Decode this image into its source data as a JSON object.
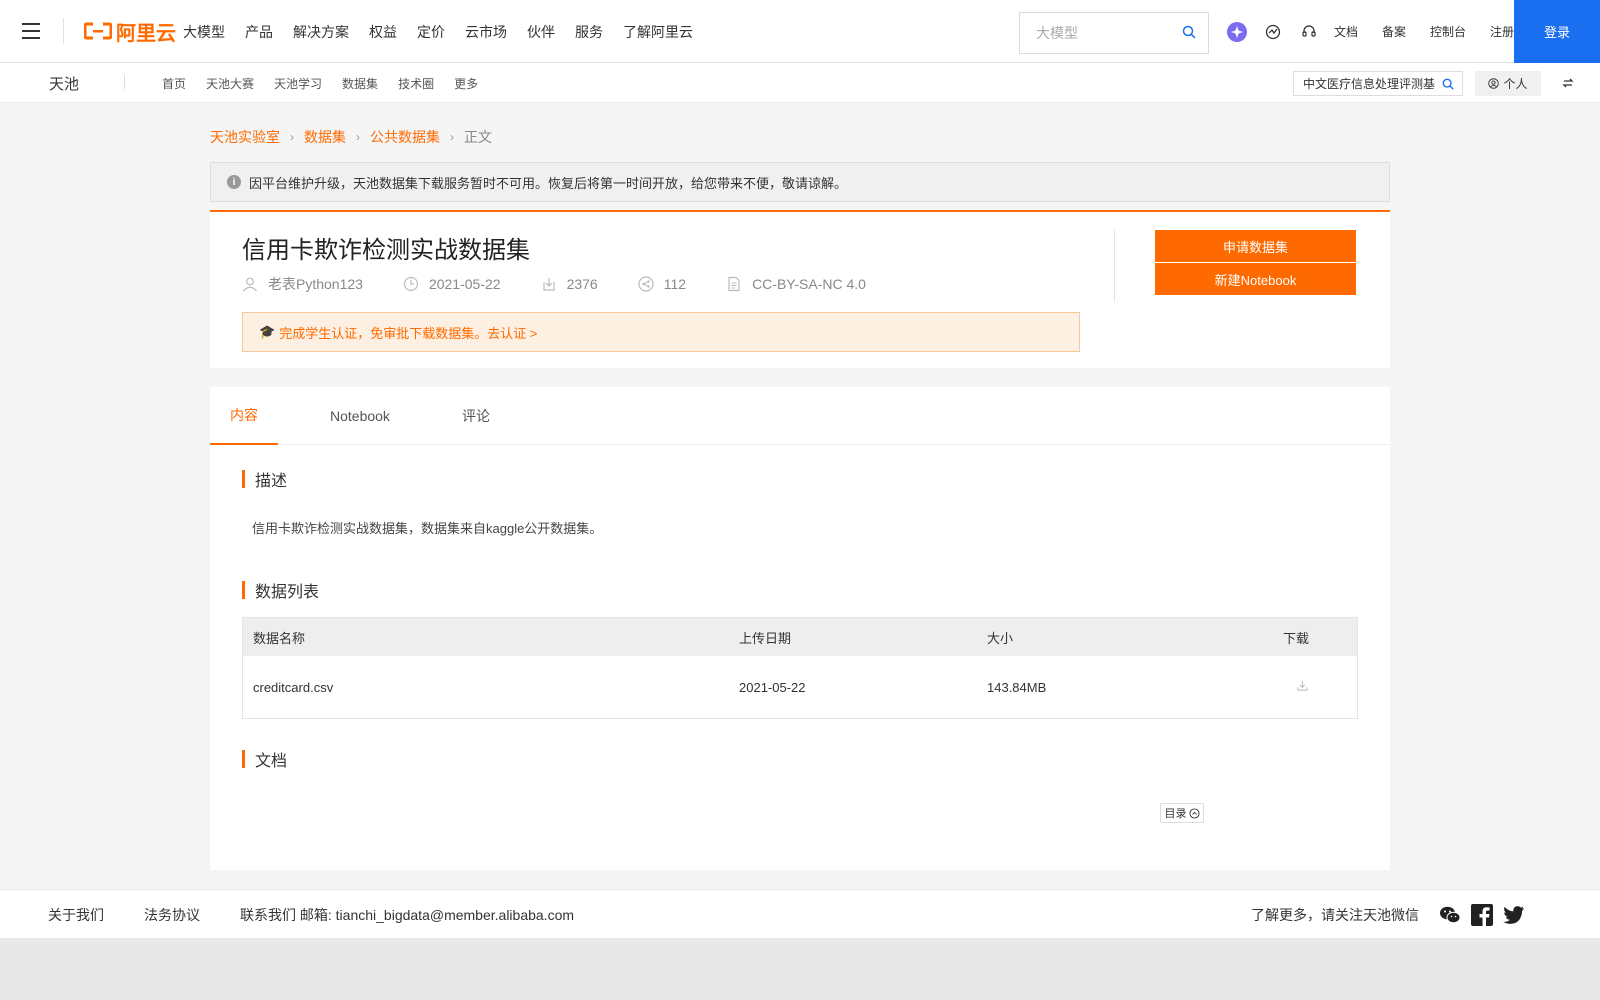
{
  "topnav": {
    "logo_text": "阿里云",
    "items": [
      "大模型",
      "产品",
      "解决方案",
      "权益",
      "定价",
      "云市场",
      "伙伴",
      "服务",
      "了解阿里云"
    ],
    "search_placeholder": "大模型",
    "links": [
      "文档",
      "备案",
      "控制台",
      "注册"
    ],
    "login_label": "登录"
  },
  "subnav": {
    "brand": "天池",
    "items": [
      "首页",
      "天池大赛",
      "天池学习",
      "数据集",
      "技术圈",
      "更多"
    ],
    "search_value": "中文医疗信息处理评测基",
    "personal_label": "个人"
  },
  "breadcrumb": [
    "天池实验室",
    "数据集",
    "公共数据集",
    "正文"
  ],
  "notice": "因平台维护升级，天池数据集下载服务暂时不可用。恢复后将第一时间开放，给您带来不便，敬请谅解。",
  "dataset": {
    "title": "信用卡欺诈检测实战数据集",
    "author": "老表Python123",
    "date": "2021-05-22",
    "downloads": "2376",
    "shares": "112",
    "license": "CC-BY-SA-NC 4.0",
    "cert_text": "完成学生认证，免审批下载数据集。去认证 >",
    "apply_label": "申请数据集",
    "notebook_label": "新建Notebook"
  },
  "tabs": [
    "内容",
    "Notebook",
    "评论"
  ],
  "content": {
    "desc_heading": "描述",
    "desc_text": "信用卡欺诈检测实战数据集，数据集来自kaggle公开数据集。",
    "list_heading": "数据列表",
    "table_headers": [
      "数据名称",
      "上传日期",
      "大小",
      "下载"
    ],
    "rows": [
      {
        "name": "creditcard.csv",
        "date": "2021-05-22",
        "size": "143.84MB"
      }
    ],
    "doc_heading": "文档",
    "toc_label": "目录"
  },
  "footer": {
    "links": [
      "关于我们",
      "法务协议",
      "联系我们 邮箱: tianchi_bigdata@member.alibaba.com"
    ],
    "follow_text": "了解更多，请关注天池微信"
  },
  "colors": {
    "accent": "#ff6a00",
    "login": "#1a6ef0"
  }
}
